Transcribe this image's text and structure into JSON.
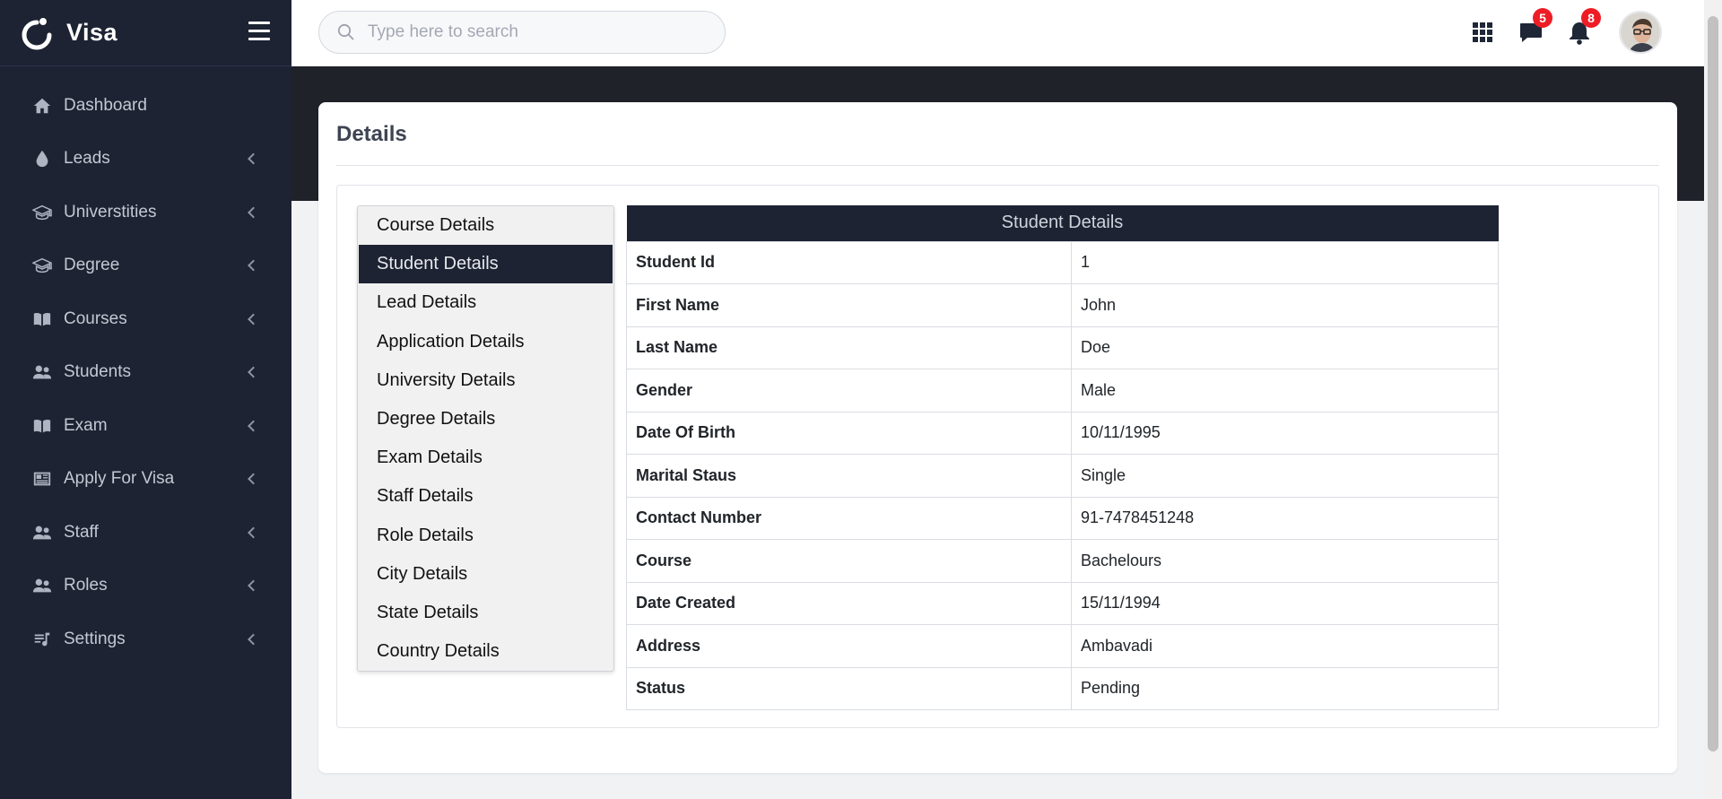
{
  "brand": {
    "name": "Visa"
  },
  "sidebar": {
    "items": [
      {
        "label": "Dashboard",
        "icon": "home-icon",
        "has_submenu": false
      },
      {
        "label": "Leads",
        "icon": "drop-icon",
        "has_submenu": true
      },
      {
        "label": "Universtities",
        "icon": "graduation-cap-icon",
        "has_submenu": true
      },
      {
        "label": "Degree",
        "icon": "graduation-cap-icon",
        "has_submenu": true
      },
      {
        "label": "Courses",
        "icon": "book-icon",
        "has_submenu": true
      },
      {
        "label": "Students",
        "icon": "users-icon",
        "has_submenu": true
      },
      {
        "label": "Exam",
        "icon": "book-icon",
        "has_submenu": true
      },
      {
        "label": "Apply For Visa",
        "icon": "newspaper-icon",
        "has_submenu": true
      },
      {
        "label": "Staff",
        "icon": "users-icon",
        "has_submenu": true
      },
      {
        "label": "Roles",
        "icon": "users-icon",
        "has_submenu": true
      },
      {
        "label": "Settings",
        "icon": "playlist-music-icon",
        "has_submenu": true
      }
    ]
  },
  "header": {
    "search": {
      "placeholder": "Type here to search",
      "value": ""
    },
    "messages_count": "5",
    "notifications_count": "8"
  },
  "main": {
    "title": "Details",
    "tabs": [
      "Course Details",
      "Student Details",
      "Lead Details",
      "Application Details",
      "University Details",
      "Degree Details",
      "Exam Details",
      "Staff Details",
      "Role Details",
      "City Details",
      "State Details",
      "Country Details"
    ],
    "active_tab": "Student Details",
    "table": {
      "header": "Student Details",
      "rows": [
        {
          "label": "Student Id",
          "value": "1"
        },
        {
          "label": "First Name",
          "value": "John"
        },
        {
          "label": "Last Name",
          "value": "Doe"
        },
        {
          "label": "Gender",
          "value": "Male"
        },
        {
          "label": "Date Of Birth",
          "value": "10/11/1995"
        },
        {
          "label": "Marital Staus",
          "value": "Single"
        },
        {
          "label": "Contact Number",
          "value": "91-7478451248"
        },
        {
          "label": "Course",
          "value": "Bachelours"
        },
        {
          "label": "Date Created",
          "value": "15/11/1994"
        },
        {
          "label": "Address",
          "value": "Ambavadi"
        },
        {
          "label": "Status",
          "value": "Pending"
        }
      ]
    }
  },
  "colors": {
    "sidebar_bg": "#1d2333",
    "accent_dark": "#1d2333",
    "badge_red": "#ee1c25",
    "band_dark": "#1f2229"
  }
}
